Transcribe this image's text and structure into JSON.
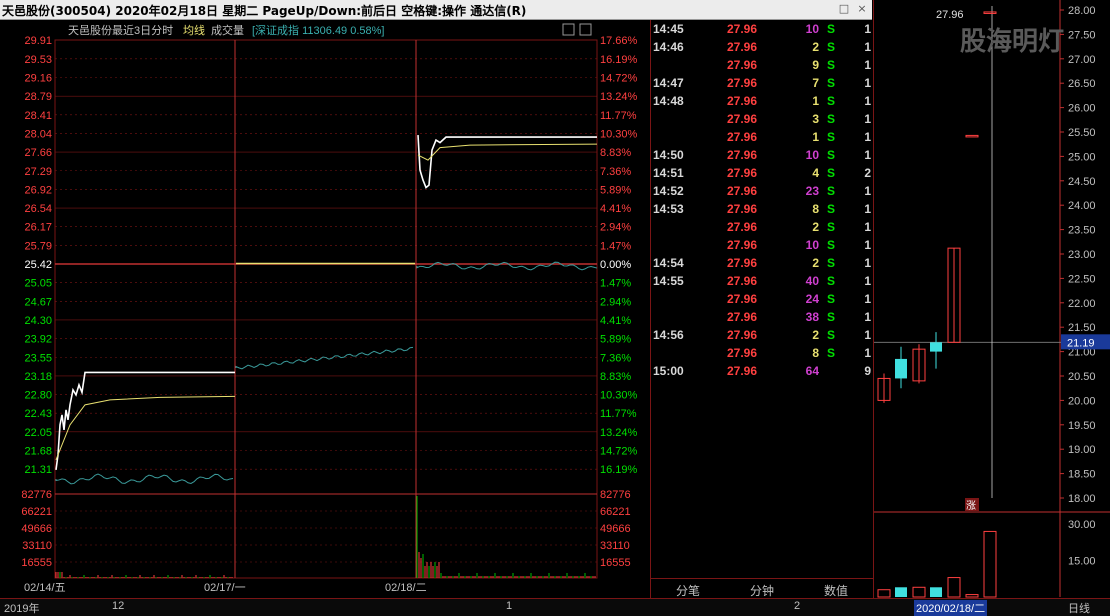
{
  "window": {
    "title": "天邑股份(300504)  2020年02月18日  星期二  PageUp/Down:前后日  空格键:操作  通达信(R)",
    "close_glyph": "×",
    "menu_glyph": "□"
  },
  "intraday": {
    "legend": {
      "name": "天邑股份",
      "period": "最近3日分时",
      "avg_label": "均线",
      "vol_label": "成交量",
      "index": "[深证成指 11306.49 0.58%]"
    },
    "prev_close": "25.42",
    "price_labels_up": [
      "29.91",
      "29.53",
      "29.16",
      "28.79",
      "28.41",
      "28.04",
      "27.66",
      "27.29",
      "26.92",
      "26.54",
      "26.17",
      "25.79"
    ],
    "price_labels_down": [
      "25.05",
      "24.67",
      "24.30",
      "23.92",
      "23.55",
      "23.18",
      "22.80",
      "22.43",
      "22.05",
      "21.68",
      "21.31"
    ],
    "pct_labels_up": [
      "17.66%",
      "16.19%",
      "14.72%",
      "13.24%",
      "11.77%",
      "10.30%",
      "8.83%",
      "7.36%",
      "5.89%",
      "4.41%",
      "2.94%",
      "1.47%"
    ],
    "pct_zero": "0.00%",
    "pct_labels_down": [
      "1.47%",
      "2.94%",
      "4.41%",
      "5.89%",
      "7.36%",
      "8.83%",
      "10.30%",
      "11.77%",
      "13.24%",
      "14.72%",
      "16.19%"
    ],
    "vol_labels": [
      "82776",
      "66221",
      "49666",
      "33110",
      "16555"
    ],
    "dates": [
      "02/14/五",
      "02/17/一",
      "02/18/二"
    ],
    "colors": {
      "up": "#ff4040",
      "down": "#00c000",
      "price_line": "#ffffff",
      "avg_line": "#e8e070",
      "index_line": "#3a9a9a",
      "grid": "#7a1515"
    }
  },
  "ticks": {
    "rows": [
      {
        "time": "14:45",
        "price": "27.96",
        "vol": "10",
        "side": "S",
        "count": "1",
        "vcolor": "#d040d0"
      },
      {
        "time": "14:46",
        "price": "27.96",
        "vol": "2",
        "side": "S",
        "count": "1",
        "vcolor": "#e8e070"
      },
      {
        "time": "",
        "price": "27.96",
        "vol": "9",
        "side": "S",
        "count": "1",
        "vcolor": "#e8e070"
      },
      {
        "time": "14:47",
        "price": "27.96",
        "vol": "7",
        "side": "S",
        "count": "1",
        "vcolor": "#e8e070"
      },
      {
        "time": "14:48",
        "price": "27.96",
        "vol": "1",
        "side": "S",
        "count": "1",
        "vcolor": "#e8e070"
      },
      {
        "time": "",
        "price": "27.96",
        "vol": "3",
        "side": "S",
        "count": "1",
        "vcolor": "#e8e070"
      },
      {
        "time": "",
        "price": "27.96",
        "vol": "1",
        "side": "S",
        "count": "1",
        "vcolor": "#e8e070"
      },
      {
        "time": "14:50",
        "price": "27.96",
        "vol": "10",
        "side": "S",
        "count": "1",
        "vcolor": "#d040d0"
      },
      {
        "time": "14:51",
        "price": "27.96",
        "vol": "4",
        "side": "S",
        "count": "2",
        "vcolor": "#e8e070"
      },
      {
        "time": "14:52",
        "price": "27.96",
        "vol": "23",
        "side": "S",
        "count": "1",
        "vcolor": "#d040d0"
      },
      {
        "time": "14:53",
        "price": "27.96",
        "vol": "8",
        "side": "S",
        "count": "1",
        "vcolor": "#e8e070"
      },
      {
        "time": "",
        "price": "27.96",
        "vol": "2",
        "side": "S",
        "count": "1",
        "vcolor": "#e8e070"
      },
      {
        "time": "",
        "price": "27.96",
        "vol": "10",
        "side": "S",
        "count": "1",
        "vcolor": "#d040d0"
      },
      {
        "time": "14:54",
        "price": "27.96",
        "vol": "2",
        "side": "S",
        "count": "1",
        "vcolor": "#e8e070"
      },
      {
        "time": "14:55",
        "price": "27.96",
        "vol": "40",
        "side": "S",
        "count": "1",
        "vcolor": "#d040d0"
      },
      {
        "time": "",
        "price": "27.96",
        "vol": "24",
        "side": "S",
        "count": "1",
        "vcolor": "#d040d0"
      },
      {
        "time": "",
        "price": "27.96",
        "vol": "38",
        "side": "S",
        "count": "1",
        "vcolor": "#d040d0"
      },
      {
        "time": "14:56",
        "price": "27.96",
        "vol": "2",
        "side": "S",
        "count": "1",
        "vcolor": "#e8e070"
      },
      {
        "time": "",
        "price": "27.96",
        "vol": "8",
        "side": "S",
        "count": "1",
        "vcolor": "#e8e070"
      },
      {
        "time": "15:00",
        "price": "27.96",
        "vol": "64",
        "side": "",
        "count": "9",
        "vcolor": "#d040d0"
      }
    ],
    "tabs": [
      "分笔",
      "分钟",
      "数值"
    ]
  },
  "kline": {
    "watermark": "股海明灯",
    "high_marker": "27.96",
    "price_labels": [
      "28.00",
      "27.50",
      "27.00",
      "26.50",
      "26.00",
      "25.50",
      "25.00",
      "24.50",
      "24.00",
      "23.50",
      "23.00",
      "22.50",
      "22.00",
      "21.50",
      "21.00",
      "20.50",
      "20.00",
      "19.50",
      "19.00",
      "18.50",
      "18.00"
    ],
    "current_price": "21.19",
    "limit_up_tag": "涨",
    "vol_labels": [
      "30.00",
      "15.00"
    ],
    "date_label": "2020/02/18/二",
    "period_label": "日线",
    "candles": [
      {
        "open": 20.0,
        "close": 20.45,
        "high": 20.55,
        "low": 19.95,
        "up": true
      },
      {
        "open": 20.85,
        "close": 20.45,
        "high": 21.1,
        "low": 20.25,
        "up": false
      },
      {
        "open": 20.4,
        "close": 21.05,
        "high": 21.15,
        "low": 20.35,
        "up": true
      },
      {
        "open": 21.19,
        "close": 21.0,
        "high": 21.4,
        "low": 20.65,
        "up": false
      },
      {
        "open": 21.19,
        "close": 23.12,
        "high": 23.12,
        "low": 21.19,
        "up": true
      },
      {
        "open": 25.43,
        "close": 25.43,
        "high": 25.43,
        "low": 25.43,
        "up": true
      },
      {
        "open": 27.96,
        "close": 27.96,
        "high": 27.96,
        "low": 27.96,
        "up": true
      }
    ],
    "volumes": [
      {
        "v": 3,
        "up": true
      },
      {
        "v": 4,
        "up": false
      },
      {
        "v": 4,
        "up": true
      },
      {
        "v": 4,
        "up": false
      },
      {
        "v": 8,
        "up": true
      },
      {
        "v": 1,
        "up": true
      },
      {
        "v": 27,
        "up": true
      }
    ]
  },
  "bottom": {
    "year": "2019年",
    "items": [
      "12",
      "1",
      "2"
    ]
  }
}
